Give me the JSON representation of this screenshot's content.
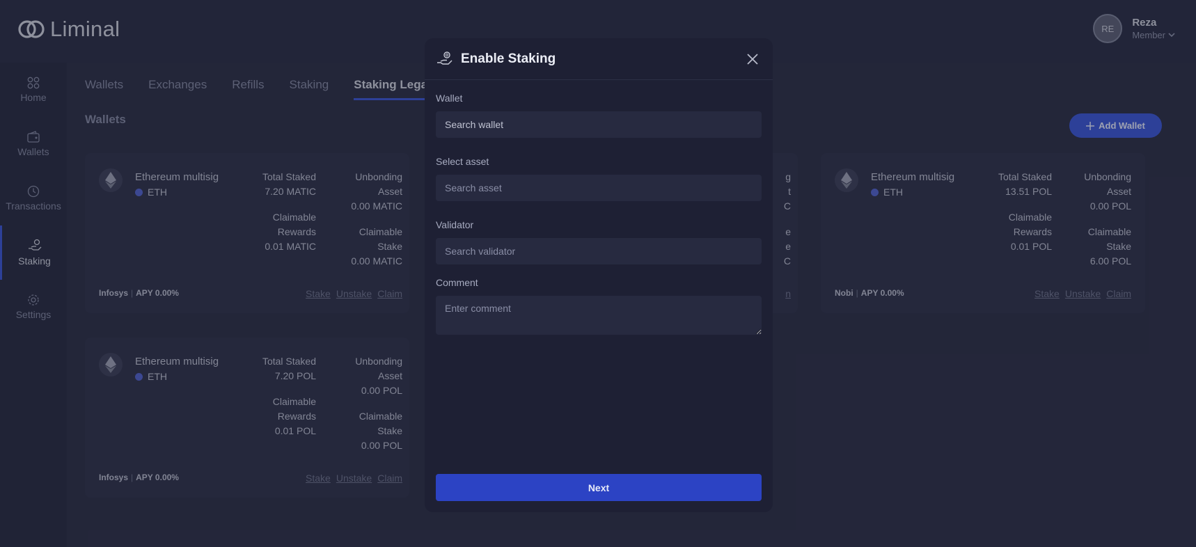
{
  "app": {
    "brand": "Liminal"
  },
  "user": {
    "initials": "RE",
    "name": "Reza",
    "role": "Member"
  },
  "sidebar": {
    "items": [
      {
        "label": "Home",
        "icon": "grid-icon"
      },
      {
        "label": "Wallets",
        "icon": "wallet-icon"
      },
      {
        "label": "Transactions",
        "icon": "clock-icon"
      },
      {
        "label": "Staking",
        "icon": "staking-hand-icon"
      },
      {
        "label": "Settings",
        "icon": "gear-icon"
      }
    ]
  },
  "tabs": [
    "Wallets",
    "Exchanges",
    "Refills",
    "Staking",
    "Staking Lega"
  ],
  "section": {
    "title": "Wallets",
    "add_button": "Add Wallet"
  },
  "cards": [
    {
      "name": "Ethereum multisig",
      "network": "ETH",
      "total_staked_label": "Total Staked",
      "total_staked": "7.20 MATIC",
      "unbonding_label_1": "Unbonding",
      "unbonding_label_2": "Asset",
      "unbonding": "0.00 MATIC",
      "rewards_label_1": "Claimable",
      "rewards_label_2": "Rewards",
      "rewards": "0.01 MATIC",
      "stake_label_1": "Claimable",
      "stake_label_2": "Stake",
      "stake": "0.00 MATIC",
      "provider": "Infosys",
      "apy": "APY 0.00%",
      "actions": [
        "Stake",
        "Unstake",
        "Claim"
      ]
    },
    {
      "name": "Ethereum multisig",
      "network": "ETH",
      "total_staked_label": "Total Staked",
      "total_staked": "13.51 POL",
      "unbonding_label_1": "Unbonding",
      "unbonding_label_2": "Asset",
      "unbonding": "0.00 POL",
      "rewards_label_1": "Claimable",
      "rewards_label_2": "Rewards",
      "rewards": "0.01 POL",
      "stake_label_1": "Claimable",
      "stake_label_2": "Stake",
      "stake": "6.00 POL",
      "provider": "Nobi",
      "apy": "APY 0.00%",
      "actions": [
        "Stake",
        "Unstake",
        "Claim"
      ]
    },
    {
      "name": "Ethereum multisig",
      "network": "ETH",
      "total_staked_label": "Total Staked",
      "total_staked": "7.20 POL",
      "unbonding_label_1": "Unbonding",
      "unbonding_label_2": "Asset",
      "unbonding": "0.00 POL",
      "rewards_label_1": "Claimable",
      "rewards_label_2": "Rewards",
      "rewards": "0.01 POL",
      "stake_label_1": "Claimable",
      "stake_label_2": "Stake",
      "stake": "0.00 POL",
      "provider": "Infosys",
      "apy": "APY 0.00%",
      "actions": [
        "Stake",
        "Unstake",
        "Claim"
      ]
    }
  ],
  "hidden_card_fragments": [
    "g",
    "t",
    "C",
    "e",
    "e",
    "C",
    "n"
  ],
  "modal": {
    "title": "Enable Staking",
    "wallet_label": "Wallet",
    "wallet_placeholder": "Search wallet",
    "asset_label": "Select asset",
    "asset_placeholder": "Search asset",
    "validator_label": "Validator",
    "validator_placeholder": "Search validator",
    "comment_label": "Comment",
    "comment_placeholder": "Enter comment",
    "next_button": "Next"
  },
  "colors": {
    "accent": "#3a55d0",
    "background": "#2a2d44",
    "modal": "#1e2034",
    "button": "#2c43c4"
  }
}
